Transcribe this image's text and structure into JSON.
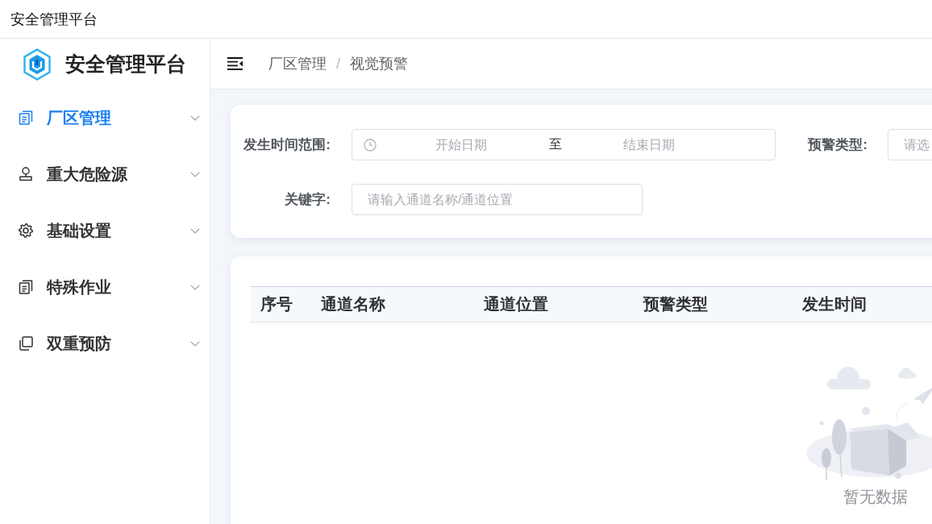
{
  "window": {
    "title": "安全管理平台"
  },
  "sidebar": {
    "title": "安全管理平台",
    "items": [
      {
        "label": "厂区管理",
        "selected": true,
        "expanded": false
      },
      {
        "label": "重大危险源",
        "selected": false,
        "expanded": false
      },
      {
        "label": "基础设置",
        "selected": false,
        "expanded": false
      },
      {
        "label": "特殊作业",
        "selected": false,
        "expanded": false
      },
      {
        "label": "双重预防",
        "selected": false,
        "expanded": false
      }
    ]
  },
  "header": {
    "breadcrumb": [
      "厂区管理",
      "视觉预警"
    ],
    "separator": "/"
  },
  "filters": [
    {
      "kind": "daterange",
      "label": "发生时间范围:",
      "start_placeholder": "开始日期",
      "range_separator": "至",
      "end_placeholder": "结束日期"
    },
    {
      "kind": "select",
      "label": "预警类型:",
      "placeholder": "请选"
    },
    {
      "kind": "text",
      "label": "关键字:",
      "placeholder": "请输入通道名称/通道位置"
    }
  ],
  "table": {
    "columns": [
      "序号",
      "通道名称",
      "通道位置",
      "预警类型",
      "发生时间"
    ],
    "empty_text": "暂无数据"
  }
}
